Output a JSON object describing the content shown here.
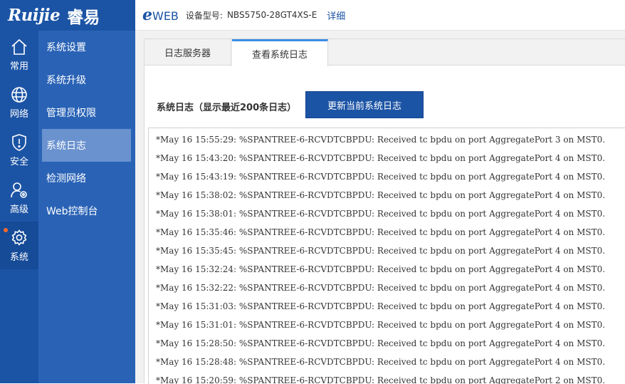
{
  "brand": {
    "logo": "Ruijie",
    "product": "睿易"
  },
  "header": {
    "eweb_e": "e",
    "eweb_rest": "WEB",
    "model_label": "设备型号:",
    "model_value": "NBS5750-28GT4XS-E",
    "detail_link": "详细"
  },
  "rail": {
    "items": [
      {
        "label": "常用",
        "icon": "home-icon"
      },
      {
        "label": "网络",
        "icon": "globe-icon"
      },
      {
        "label": "安全",
        "icon": "shield-icon"
      },
      {
        "label": "高级",
        "icon": "user-gear-icon"
      },
      {
        "label": "系统",
        "icon": "gear-icon",
        "active": true,
        "notice_dot": true
      }
    ]
  },
  "submenu": {
    "items": [
      {
        "label": "系统设置"
      },
      {
        "label": "系统升级"
      },
      {
        "label": "管理员权限"
      },
      {
        "label": "系统日志",
        "active": true
      },
      {
        "label": "检测网络"
      },
      {
        "label": "Web控制台"
      }
    ]
  },
  "tabs": [
    {
      "label": "日志服务器"
    },
    {
      "label": "查看系统日志",
      "active": true
    }
  ],
  "syslog": {
    "title": "系统日志（显示最近200条日志）",
    "refresh_button": "更新当前系统日志",
    "lines": [
      "*May 16 15:55:29: %SPANTREE-6-RCVDTCBPDU: Received tc bpdu on port AggregatePort 3 on MST0.",
      "*May 16 15:43:20: %SPANTREE-6-RCVDTCBPDU: Received tc bpdu on port AggregatePort 4 on MST0.",
      "*May 16 15:43:19: %SPANTREE-6-RCVDTCBPDU: Received tc bpdu on port AggregatePort 4 on MST0.",
      "*May 16 15:38:02: %SPANTREE-6-RCVDTCBPDU: Received tc bpdu on port AggregatePort 4 on MST0.",
      "*May 16 15:38:01: %SPANTREE-6-RCVDTCBPDU: Received tc bpdu on port AggregatePort 4 on MST0.",
      "*May 16 15:35:46: %SPANTREE-6-RCVDTCBPDU: Received tc bpdu on port AggregatePort 4 on MST0.",
      "*May 16 15:35:45: %SPANTREE-6-RCVDTCBPDU: Received tc bpdu on port AggregatePort 4 on MST0.",
      "*May 16 15:32:24: %SPANTREE-6-RCVDTCBPDU: Received tc bpdu on port AggregatePort 4 on MST0.",
      "*May 16 15:32:22: %SPANTREE-6-RCVDTCBPDU: Received tc bpdu on port AggregatePort 4 on MST0.",
      "*May 16 15:31:03: %SPANTREE-6-RCVDTCBPDU: Received tc bpdu on port AggregatePort 4 on MST0.",
      "*May 16 15:31:01: %SPANTREE-6-RCVDTCBPDU: Received tc bpdu on port AggregatePort 4 on MST0.",
      "*May 16 15:28:50: %SPANTREE-6-RCVDTCBPDU: Received tc bpdu on port AggregatePort 4 on MST0.",
      "*May 16 15:28:48: %SPANTREE-6-RCVDTCBPDU: Received tc bpdu on port AggregatePort 4 on MST0.",
      "*May 16 15:20:59: %SPANTREE-6-RCVDTCBPDU: Received tc bpdu on port AggregatePort 2 on MST0."
    ]
  },
  "colors": {
    "brand_blue": "#1c54a5",
    "submenu_blue": "#2a63b6",
    "submenu_active": "#6a92cf",
    "tab_accent": "#3a8ee6",
    "notice_dot": "#ff6a2b"
  }
}
